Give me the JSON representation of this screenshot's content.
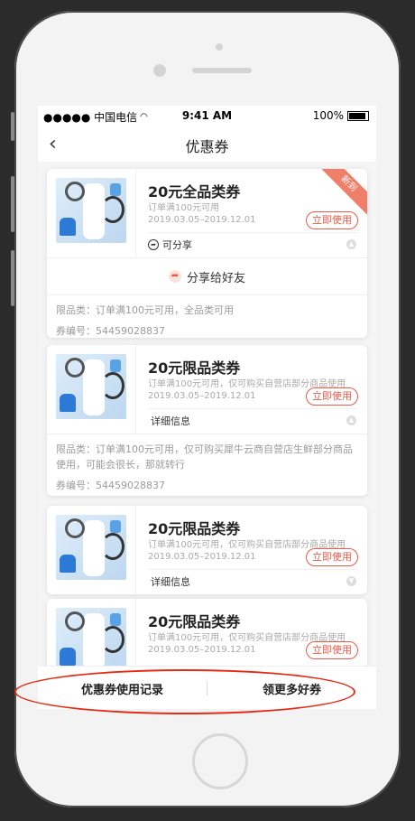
{
  "status": {
    "carrier": "●●●●● 中国电信",
    "time": "9:41 AM",
    "battery": "100%"
  },
  "nav": {
    "back": "‹",
    "title": "优惠券"
  },
  "coupons": [
    {
      "title": "20元全品类券",
      "condition": "订单满100元可用",
      "date": "2019.03.05–2019.12.01",
      "use_label": "立即使用",
      "badge": "新到",
      "footer": "可分享",
      "share_label": "分享给好友",
      "detail_lines": [
        "限品类：订单满100元可用，全品类可用",
        "券编号：54459028837"
      ]
    },
    {
      "title": "20元限品类券",
      "condition": "订单满100元可用，仅可购买自营店部分商品使用",
      "date": "2019.03.05–2019.12.01",
      "use_label": "立即使用",
      "footer": "详细信息",
      "detail_lines": [
        "限品类：订单满100元可用，仅可购买犀牛云商自营店生鲜部分商品使用，可能会很长，那就转行",
        "券编号：54459028837"
      ]
    },
    {
      "title": "20元限品类券",
      "condition": "订单满100元可用，仅可购买自营店部分商品使用",
      "date": "2019.03.05–2019.12.01",
      "use_label": "立即使用",
      "footer": "详细信息"
    },
    {
      "title": "20元限品类券",
      "condition": "订单满100元可用，仅可购买自营店部分商品使用",
      "date": "2019.03.05–2019.12.01",
      "use_label": "立即使用"
    }
  ],
  "bottom": {
    "left": "优惠券使用记录",
    "right": "领更多好券"
  },
  "colors": {
    "accent": "#e85d4a",
    "ribbon": "#f07f6a",
    "annotation": "#e42b14"
  }
}
